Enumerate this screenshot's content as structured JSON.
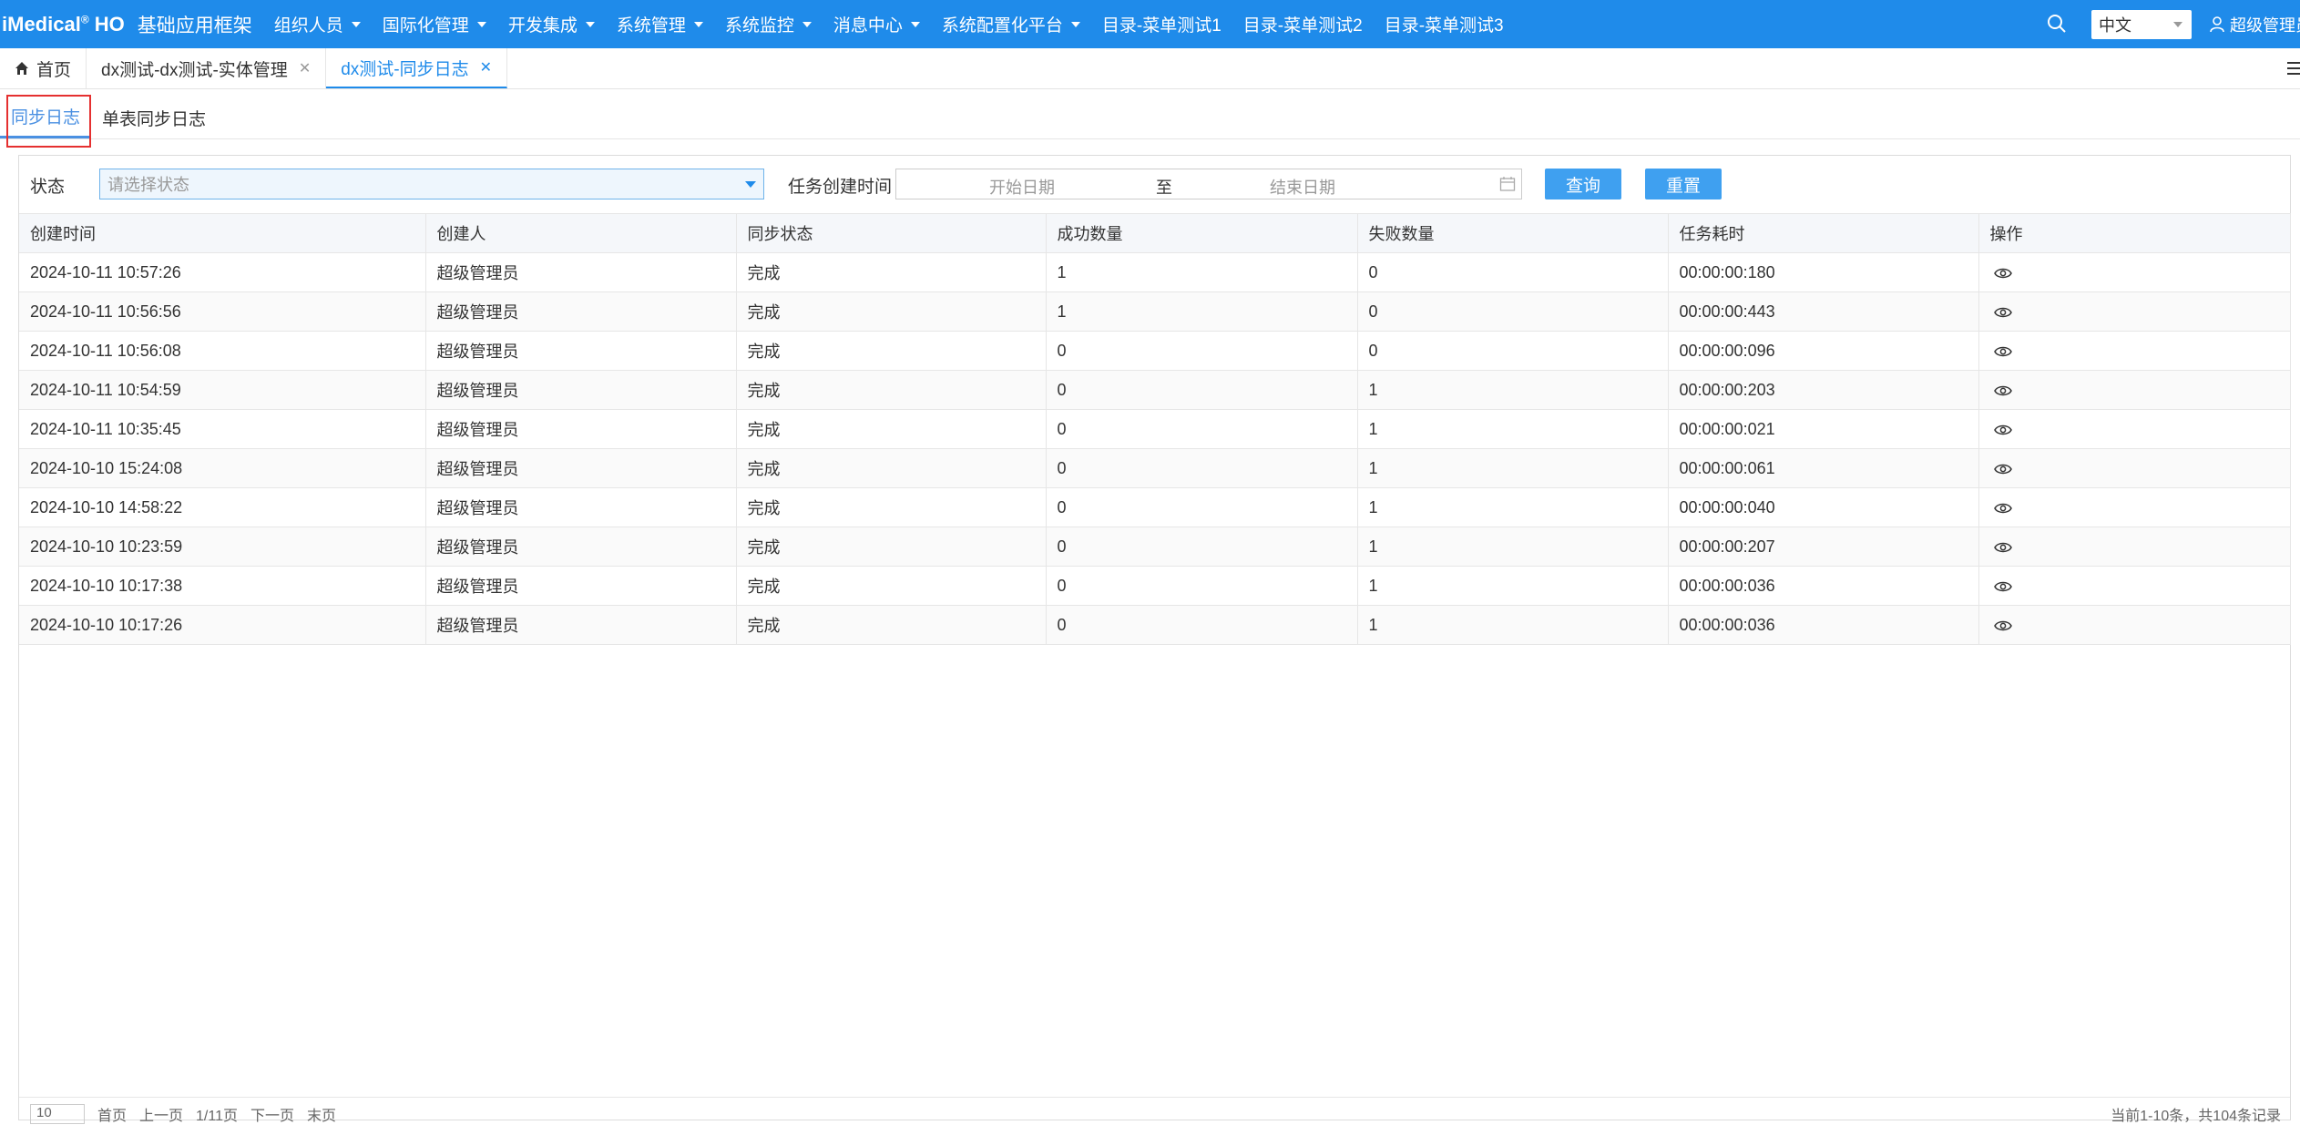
{
  "header": {
    "logo": "iMedical",
    "logo_mark": "®",
    "logo_suffix": "HO",
    "app_title": "基础应用框架",
    "menu": [
      {
        "label": "组织人员",
        "dropdown": true
      },
      {
        "label": "国际化管理",
        "dropdown": true
      },
      {
        "label": "开发集成",
        "dropdown": true
      },
      {
        "label": "系统管理",
        "dropdown": true
      },
      {
        "label": "系统监控",
        "dropdown": true
      },
      {
        "label": "消息中心",
        "dropdown": true
      },
      {
        "label": "系统配置化平台",
        "dropdown": true
      },
      {
        "label": "目录-菜单测试1",
        "dropdown": false
      },
      {
        "label": "目录-菜单测试2",
        "dropdown": false
      },
      {
        "label": "目录-菜单测试3",
        "dropdown": false
      }
    ],
    "language": "中文",
    "user": "超级管理员"
  },
  "page_tabs": [
    {
      "label": "首页",
      "icon": "home-icon",
      "active": false,
      "closable": false
    },
    {
      "label": "dx测试-dx测试-实体管理",
      "active": false,
      "closable": true
    },
    {
      "label": "dx测试-同步日志",
      "active": true,
      "closable": true
    }
  ],
  "sub_tabs": [
    {
      "label": "同步日志",
      "active": true
    },
    {
      "label": "单表同步日志",
      "active": false
    }
  ],
  "filters": {
    "status_label": "状态",
    "status_placeholder": "请选择状态",
    "time_label": "任务创建时间",
    "start_placeholder": "开始日期",
    "range_separator": "至",
    "end_placeholder": "结束日期",
    "query_button": "查询",
    "reset_button": "重置"
  },
  "table": {
    "columns": [
      "创建时间",
      "创建人",
      "同步状态",
      "成功数量",
      "失败数量",
      "任务耗时",
      "操作"
    ],
    "rows": [
      [
        "2024-10-11 10:57:26",
        "超级管理员",
        "完成",
        "1",
        "0",
        "00:00:00:180"
      ],
      [
        "2024-10-11 10:56:56",
        "超级管理员",
        "完成",
        "1",
        "0",
        "00:00:00:443"
      ],
      [
        "2024-10-11 10:56:08",
        "超级管理员",
        "完成",
        "0",
        "0",
        "00:00:00:096"
      ],
      [
        "2024-10-11 10:54:59",
        "超级管理员",
        "完成",
        "0",
        "1",
        "00:00:00:203"
      ],
      [
        "2024-10-11 10:35:45",
        "超级管理员",
        "完成",
        "0",
        "1",
        "00:00:00:021"
      ],
      [
        "2024-10-10 15:24:08",
        "超级管理员",
        "完成",
        "0",
        "1",
        "00:00:00:061"
      ],
      [
        "2024-10-10 14:58:22",
        "超级管理员",
        "完成",
        "0",
        "1",
        "00:00:00:040"
      ],
      [
        "2024-10-10 10:23:59",
        "超级管理员",
        "完成",
        "0",
        "1",
        "00:00:00:207"
      ],
      [
        "2024-10-10 10:17:38",
        "超级管理员",
        "完成",
        "0",
        "1",
        "00:00:00:036"
      ],
      [
        "2024-10-10 10:17:26",
        "超级管理员",
        "完成",
        "0",
        "1",
        "00:00:00:036"
      ]
    ],
    "action_icon": "eye-icon"
  },
  "pagination": {
    "page_size": "10",
    "first": "首页",
    "prev": "上一页",
    "page_info": "1/11页",
    "next": "下一页",
    "last": "末页",
    "info": "当前1-10条，共104条记录"
  },
  "colors": {
    "header_bg": "#1f8bea",
    "accent": "#4a90e2",
    "button": "#3fa0f0",
    "highlight": "#e53030"
  }
}
